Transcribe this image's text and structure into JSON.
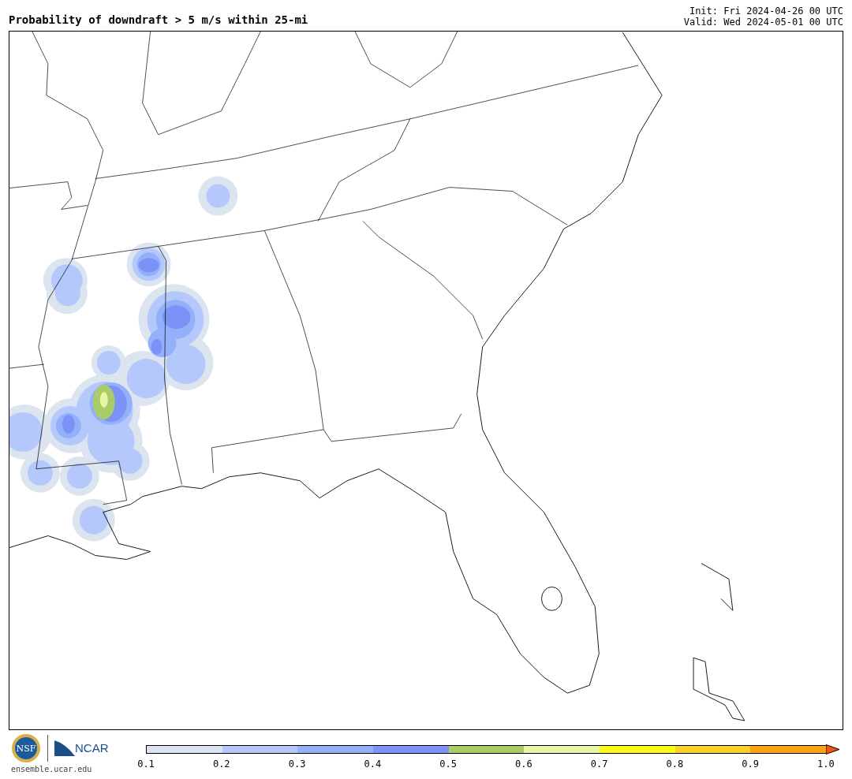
{
  "title": "Probability of downdraft > 5 m/s within 25-mi",
  "init": "Init: Fri 2024-04-26 00 UTC",
  "valid": "Valid: Wed 2024-05-01 00 UTC",
  "logos": {
    "nsf": "NSF",
    "ncar": "NCAR",
    "url": "ensemble.ucar.edu"
  },
  "colorbar": {
    "segments": [
      {
        "color": "#dbe4ef"
      },
      {
        "color": "#b4c8fb"
      },
      {
        "color": "#93b0fb"
      },
      {
        "color": "#7c92f6"
      },
      {
        "color": "#a9cc66"
      },
      {
        "color": "#e8f5a3"
      },
      {
        "color": "#fbfb14"
      },
      {
        "color": "#fbd129"
      },
      {
        "color": "#fba212"
      },
      {
        "kind": "arrow",
        "color": "#f0540c"
      }
    ],
    "ticks": [
      "0.1",
      "0.2",
      "0.3",
      "0.4",
      "0.5",
      "0.6",
      "0.7",
      "0.8",
      "0.9",
      "1.0"
    ]
  }
}
